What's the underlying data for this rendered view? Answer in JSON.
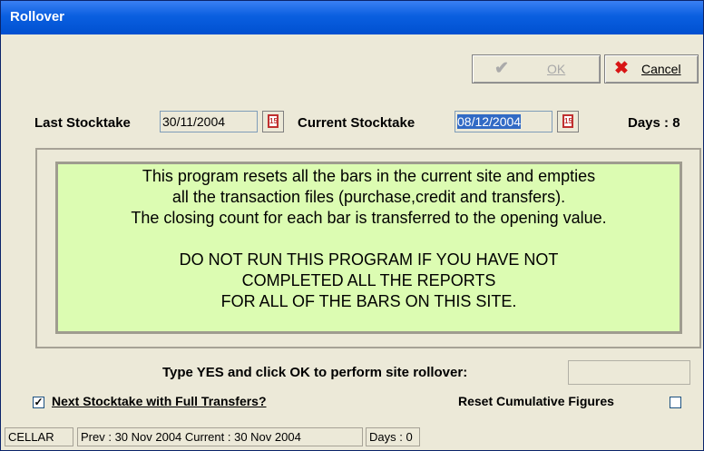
{
  "window": {
    "title": "Rollover"
  },
  "toolbar": {
    "ok_label": "OK",
    "cancel_label": "Cancel"
  },
  "dates": {
    "last_label": "Last Stocktake",
    "last_value": "30/11/2004",
    "current_label": "Current Stocktake",
    "current_value": "08/12/2004",
    "days_label": "Days : 8"
  },
  "message": {
    "lines": [
      "This program resets all the bars in the current site and empties",
      "all the transaction files (purchase,credit and transfers).",
      "The closing count for each bar is transferred to the opening value.",
      "",
      "DO NOT RUN THIS PROGRAM IF YOU HAVE NOT",
      "COMPLETED ALL THE REPORTS",
      "FOR ALL OF THE BARS ON THIS SITE."
    ]
  },
  "confirm": {
    "prompt": "Type YES and click OK to perform site rollover:",
    "value": ""
  },
  "options": {
    "full_transfers_label": "Next Stocktake with Full Transfers?",
    "full_transfers_checked": true,
    "check_mark": "✓",
    "reset_cumulative_label": "Reset Cumulative Figures",
    "reset_cumulative_checked": false
  },
  "statusbar": {
    "site": "CELLAR",
    "dates": "Prev : 30 Nov 2004  Current : 30 Nov 2004",
    "days": "Days : 0"
  },
  "icons": {
    "ok": "check-icon",
    "cancel": "x-icon",
    "calendar": "calendar-icon"
  },
  "colors": {
    "titlebar": "#0a5fe0",
    "message_bg": "#dcfcb2",
    "selection": "#316ac5"
  }
}
